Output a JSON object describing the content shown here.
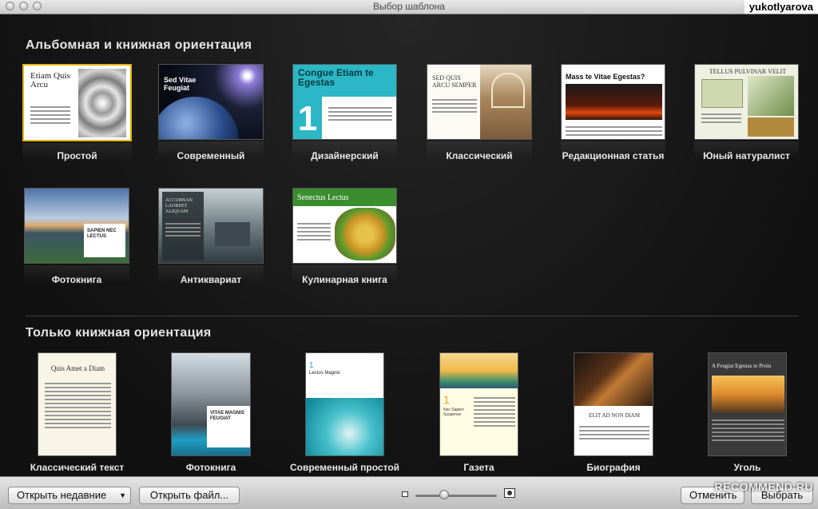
{
  "window": {
    "title": "Выбор шаблона",
    "user_tag": "yukotlyarova"
  },
  "section_landscape": {
    "title": "Альбомная и книжная ориентация",
    "items": [
      {
        "label": "Простой",
        "name": "simple",
        "head": "Etiam Quis Arcu"
      },
      {
        "label": "Современный",
        "name": "modern",
        "head": "Sed Vitae Feugiat"
      },
      {
        "label": "Дизайнерский",
        "name": "designer",
        "head": "Congue Etiam te Egestas"
      },
      {
        "label": "Классический",
        "name": "classic",
        "head": "SED QUIS ARCU SEMPER"
      },
      {
        "label": "Редакционная статья",
        "name": "editorial",
        "head": "Mass te Vitae Egestas?"
      },
      {
        "label": "Юный натуралист",
        "name": "naturalist",
        "head": "TELLUS PULVINAR VELIT"
      },
      {
        "label": "Фотокнига",
        "name": "photobook",
        "head": "SAPIEN NEC LECTUS"
      },
      {
        "label": "Антиквариат",
        "name": "antique",
        "head": "ACCUMSAN LAOREET ALIQUAM"
      },
      {
        "label": "Кулинарная книга",
        "name": "cookbook",
        "head": "Senectus Lectus"
      }
    ]
  },
  "section_portrait": {
    "title": "Только книжная ориентация",
    "items": [
      {
        "label": "Классический текст",
        "name": "classic-text",
        "head": "Quis Amet a Diam"
      },
      {
        "label": "Фотокнига",
        "name": "photobook-portrait",
        "head": "VITAE MAGNIS FEUGIAT"
      },
      {
        "label": "Современный простой",
        "name": "modern-simple",
        "head": "Lectus Magnis"
      },
      {
        "label": "Газета",
        "name": "newspaper",
        "head": "Nec Sapien Suspense"
      },
      {
        "label": "Биография",
        "name": "biography",
        "head": "ELIT AD NON DIAM"
      },
      {
        "label": "Уголь",
        "name": "charcoal",
        "head": "A Feugiat Egestas te Proin"
      }
    ]
  },
  "toolbar": {
    "open_recent": "Открыть недавние",
    "open_file": "Открыть файл...",
    "cancel": "Отменить",
    "choose": "Выбрать",
    "zoom_level": 0.35
  },
  "watermark": "RECOMMEND.RU",
  "colors": {
    "selection": "#e3b400",
    "background": "#1b1b1b"
  }
}
